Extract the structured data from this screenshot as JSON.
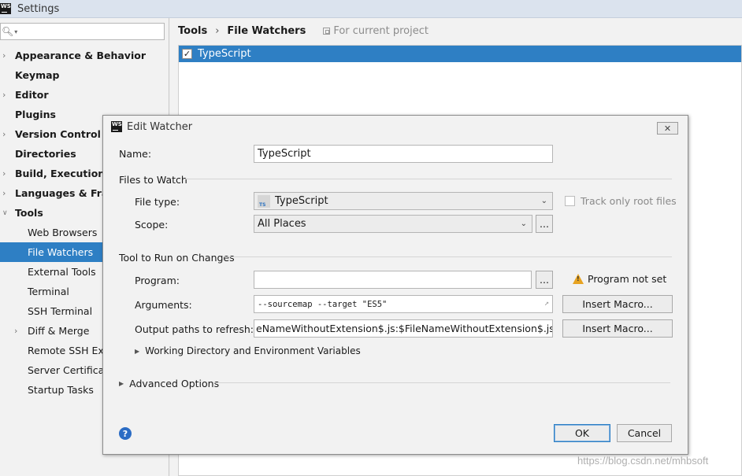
{
  "window": {
    "title": "Settings"
  },
  "sidebar": {
    "search_value": "",
    "items": [
      {
        "label": "Appearance & Behavior",
        "level": 0,
        "arrow": true
      },
      {
        "label": "Keymap",
        "level": 0,
        "arrow": false
      },
      {
        "label": "Editor",
        "level": 0,
        "arrow": true
      },
      {
        "label": "Plugins",
        "level": 0,
        "arrow": false
      },
      {
        "label": "Version Control",
        "level": 0,
        "arrow": true
      },
      {
        "label": "Directories",
        "level": 0,
        "arrow": false
      },
      {
        "label": "Build, Execution, D",
        "level": 0,
        "arrow": true
      },
      {
        "label": "Languages & Fram",
        "level": 0,
        "arrow": true
      },
      {
        "label": "Tools",
        "level": 0,
        "arrow": "open"
      },
      {
        "label": "Web Browsers",
        "level": 1
      },
      {
        "label": "File Watchers",
        "level": 1,
        "selected": true
      },
      {
        "label": "External Tools",
        "level": 1
      },
      {
        "label": "Terminal",
        "level": 1
      },
      {
        "label": "SSH Terminal",
        "level": 1
      },
      {
        "label": "Diff & Merge",
        "level": 1,
        "arrow": true
      },
      {
        "label": "Remote SSH Exte",
        "level": 1
      },
      {
        "label": "Server Certificate",
        "level": 1
      },
      {
        "label": "Startup Tasks",
        "level": 1
      }
    ]
  },
  "breadcrumb": {
    "root": "Tools",
    "separator": "›",
    "current": "File Watchers",
    "scope_note": "For current project"
  },
  "watchers": [
    {
      "name": "TypeScript",
      "enabled": true
    }
  ],
  "dialog": {
    "title": "Edit Watcher",
    "name_label": "Name:",
    "name_value": "TypeScript",
    "files_section": "Files to Watch",
    "file_type_label": "File type:",
    "file_type_value": "TypeScript",
    "file_type_icon": "TS",
    "track_root_label": "Track only root files",
    "track_root_checked": false,
    "scope_label": "Scope:",
    "scope_value": "All Places",
    "browse_label": "...",
    "tool_section": "Tool to Run on Changes",
    "program_label": "Program:",
    "program_value": "",
    "program_warning": "Program not set",
    "arguments_label": "Arguments:",
    "arguments_value": "--sourcemap --target \"ES5\"",
    "output_label": "Output paths to refresh:",
    "output_value": "eNameWithoutExtension$.js:$FileNameWithoutExtension$.js.map",
    "insert_macro_label": "Insert Macro...",
    "working_dir_label": "Working Directory and Environment Variables",
    "advanced_label": "Advanced Options",
    "ok_label": "OK",
    "cancel_label": "Cancel",
    "help_label": "?"
  },
  "watermark": "https://blog.csdn.net/mhbsoft",
  "colors": {
    "selection": "#2e7fc4",
    "warning": "#e7a321",
    "help": "#2b6cc4"
  }
}
